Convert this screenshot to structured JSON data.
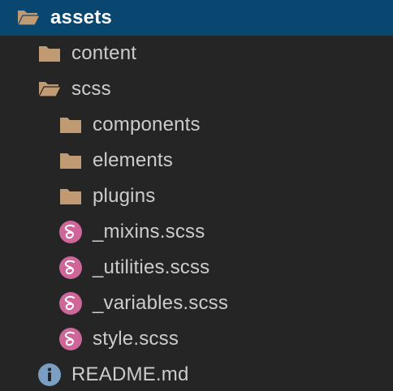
{
  "explorer": {
    "items": [
      {
        "label": "assets",
        "icon": "folder-open-icon"
      },
      {
        "label": "content",
        "icon": "folder-icon"
      },
      {
        "label": "scss",
        "icon": "folder-open-icon"
      },
      {
        "label": "components",
        "icon": "folder-icon"
      },
      {
        "label": "elements",
        "icon": "folder-icon"
      },
      {
        "label": "plugins",
        "icon": "folder-icon"
      },
      {
        "label": "_mixins.scss",
        "icon": "sass-file-icon"
      },
      {
        "label": "_utilities.scss",
        "icon": "sass-file-icon"
      },
      {
        "label": "_variables.scss",
        "icon": "sass-file-icon"
      },
      {
        "label": "style.scss",
        "icon": "sass-file-icon"
      },
      {
        "label": "README.md",
        "icon": "info-file-icon"
      }
    ]
  },
  "colors": {
    "background": "#252526",
    "selection": "#094771",
    "folder": "#c09a72",
    "sass": "#cd6799",
    "info": "#7a9fc2",
    "text": "#cccccc"
  }
}
